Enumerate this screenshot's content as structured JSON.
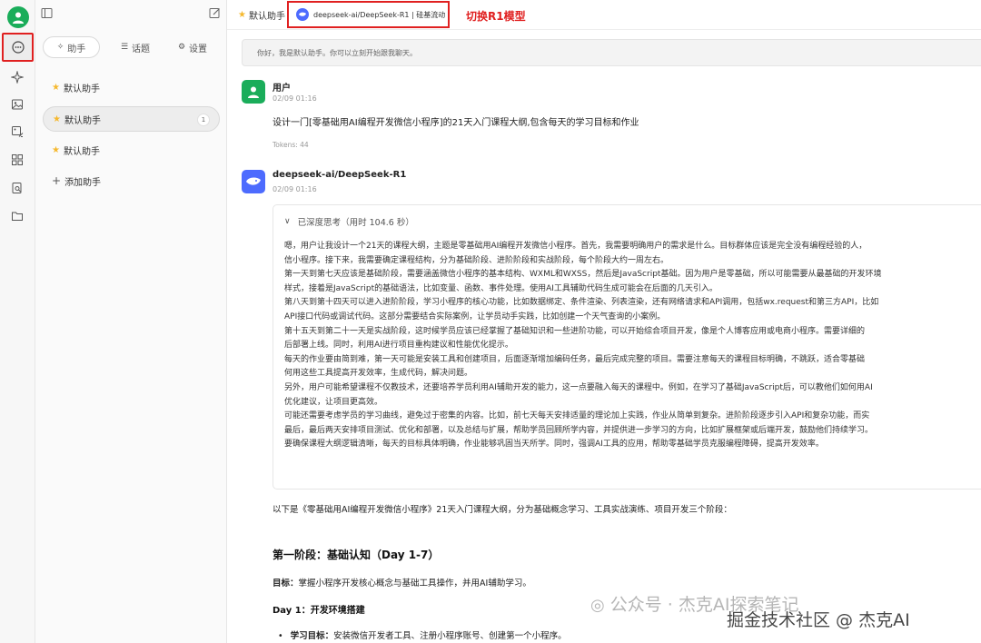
{
  "sidebar": {
    "items": [
      "chat",
      "sparkle",
      "image",
      "image-edit",
      "apps",
      "file-search",
      "folder"
    ]
  },
  "assistant_panel": {
    "tabs": [
      {
        "label": "助手",
        "icon": "sparkle-icon"
      },
      {
        "label": "话题",
        "icon": "list-icon"
      },
      {
        "label": "设置",
        "icon": "gear-icon"
      }
    ],
    "assistants": [
      {
        "label": "默认助手",
        "count": ""
      },
      {
        "label": "默认助手",
        "count": "1"
      },
      {
        "label": "默认助手",
        "count": ""
      }
    ],
    "add_label": "添加助手"
  },
  "topbar": {
    "assistant_label": "默认助手",
    "model_label": "deepseek-ai/DeepSeek-R1 | 硅基流动",
    "annotation": "切换R1模型"
  },
  "chat": {
    "system_message": "你好，我是默认助手。你可以立刻开始跟我聊天。",
    "user": {
      "name": "用户",
      "time": "02/09 01:16",
      "text": "设计一门[零基础用AI编程开发微信小程序]的21天入门课程大纲,包含每天的学习目标和作业",
      "tokens": "Tokens: 44"
    },
    "assistant": {
      "name": "deepseek-ai/DeepSeek-R1",
      "time": "02/09 01:16",
      "thinking_title": "已深度思考（用时 104.6 秒）",
      "thinking_lines": [
        "嗯，用户让我设计一个21天的课程大纲，主题是零基础用AI编程开发微信小程序。首先，我需要明确用户的需求是什么。目标群体应该是完全没有编程经验的人，",
        "信小程序。接下来，我需要确定课程结构，分为基础阶段、进阶阶段和实战阶段，每个阶段大约一周左右。",
        "第一天到第七天应该是基础阶段，需要涵盖微信小程序的基本结构、WXML和WXSS，然后是JavaScript基础。因为用户是零基础，所以可能需要从最基础的开发环境",
        "样式，接着是JavaScript的基础语法，比如变量、函数、事件处理。使用AI工具辅助代码生成可能会在后面的几天引入。",
        "第八天到第十四天可以进入进阶阶段，学习小程序的核心功能，比如数据绑定、条件渲染、列表渲染，还有网络请求和API调用，包括wx.request和第三方API，比如",
        "API接口代码或调试代码。这部分需要结合实际案例，让学员动手实践，比如创建一个天气查询的小案例。",
        "第十五天到第二十一天是实战阶段，这时候学员应该已经掌握了基础知识和一些进阶功能，可以开始综合项目开发，像是个人博客应用或电商小程序。需要详细的",
        "后部署上线。同时，利用AI进行项目重构建议和性能优化提示。",
        "每天的作业要由简到难，第一天可能是安装工具和创建项目，后面逐渐增加编码任务，最后完成完整的项目。需要注意每天的课程目标明确，不跳跃，适合零基础",
        "何用这些工具提高开发效率，生成代码，解决问题。",
        "另外，用户可能希望课程不仅教技术，还要培养学员利用AI辅助开发的能力，这一点要融入每天的课程中。例如，在学习了基础JavaScript后，可以教他们如何用AI",
        "优化建议，让项目更高效。",
        "可能还需要考虑学员的学习曲线，避免过于密集的内容。比如，前七天每天安排适量的理论加上实践，作业从简单到复杂。进阶阶段逐步引入API和复杂功能，而实",
        "最后，最后两天安排项目测试、优化和部署，以及总结与扩展，帮助学员回顾所学内容，并提供进一步学习的方向，比如扩展框架或后端开发，鼓励他们持续学习。",
        "要确保课程大纲逻辑清晰，每天的目标具体明确，作业能够巩固当天所学。同时，强调AI工具的应用，帮助零基础学员克服编程障碍，提高开发效率。"
      ],
      "intro": "以下是《零基础用AI编程开发微信小程序》21天入门课程大纲，分为基础概念学习、工具实战演练、项目开发三个阶段：",
      "stage_title": "第一阶段：基础认知（Day 1-7）",
      "goal_label": "目标：",
      "goal_text": "掌握小程序开发核心概念与基础工具操作，并用AI辅助学习。",
      "day_title": "Day 1：开发环境搭建",
      "bullet_label": "学习目标：",
      "bullet_text": "安装微信开发者工具、注册小程序账号、创建第一个小程序。"
    }
  },
  "watermark": {
    "left": "公众号 · 杰克AI探索笔记",
    "right": "掘金技术社区 @ 杰克AI"
  },
  "colors": {
    "brand_green": "#1aad5a",
    "deepseek_blue": "#4d6bfe",
    "highlight_red": "#e02020",
    "star_yellow": "#f5b82e"
  }
}
